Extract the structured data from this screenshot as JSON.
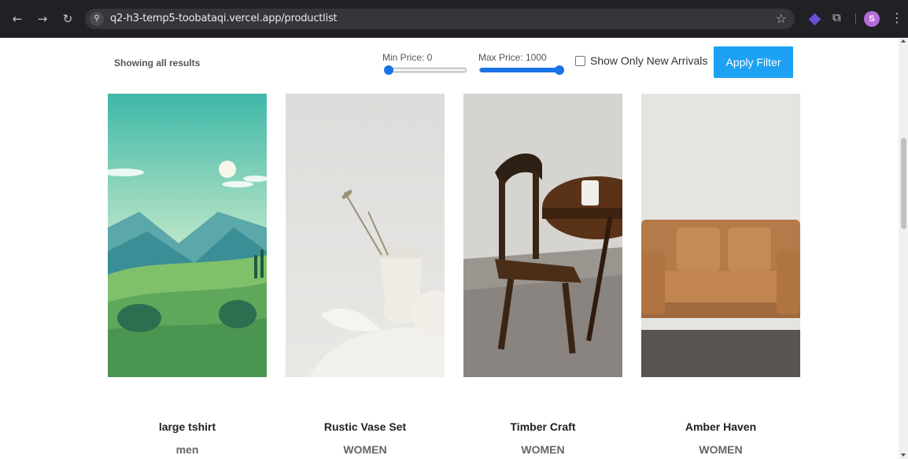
{
  "browser": {
    "url": "q2-h3-temp5-toobataqi.vercel.app/productlist",
    "avatar_letter": "S",
    "back_icon": "←",
    "forward_icon": "→",
    "reload_icon": "↻",
    "site_info_icon": "⚲",
    "star_icon": "☆",
    "puzzle_icon": "⧉",
    "menu_icon": "⋮"
  },
  "toolbar": {
    "results_text": "Showing all results",
    "min_price_label": "Min Price: 0",
    "max_price_label": "Max Price: 1000",
    "min_price_value": 0,
    "max_price_value": 1000,
    "new_arrivals_label": "Show Only New Arrivals",
    "new_arrivals_checked": false,
    "apply_label": "Apply Filter"
  },
  "products": [
    {
      "title": "large tshirt",
      "category": "men",
      "image": "landscape-illustration"
    },
    {
      "title": "Rustic Vase Set",
      "category": "WOMEN",
      "image": "white-vase-photo"
    },
    {
      "title": "Timber Craft",
      "category": "WOMEN",
      "image": "wooden-chair-photo"
    },
    {
      "title": "Amber Haven",
      "category": "WOMEN",
      "image": "leather-sofa-photo"
    }
  ],
  "colors": {
    "accent": "#1da1f2",
    "slider": "#1a73e8",
    "chrome_bg": "#202124"
  }
}
